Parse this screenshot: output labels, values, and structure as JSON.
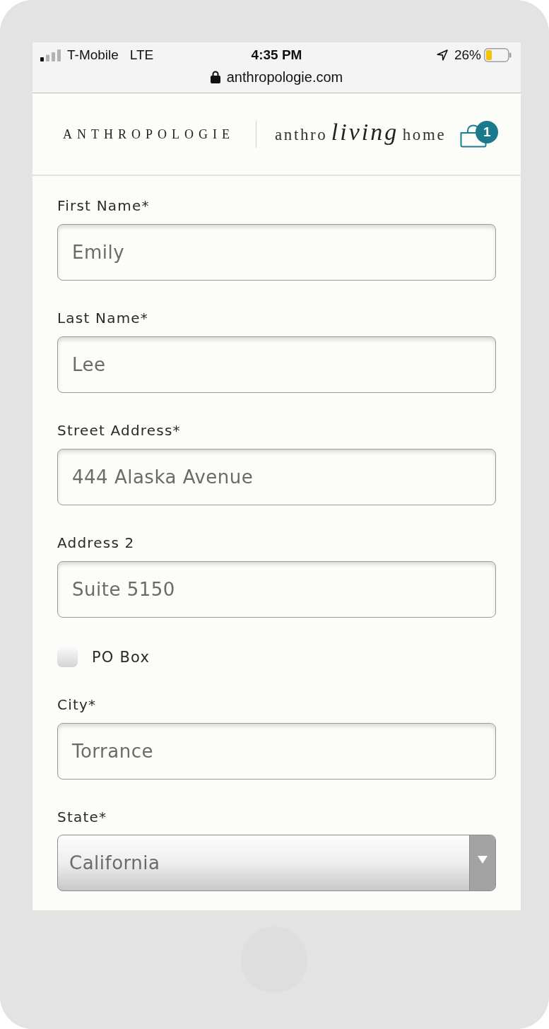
{
  "status_bar": {
    "carrier": "T-Mobile",
    "network": "LTE",
    "time": "4:35 PM",
    "battery": "26%"
  },
  "address_bar": {
    "url": "anthropologie.com"
  },
  "header": {
    "brand": "ANTHROPOLOGIE",
    "sub_brand": [
      {
        "text": "anthro",
        "kind": "serif"
      },
      {
        "text": "living",
        "kind": "script"
      },
      {
        "text": "home",
        "kind": "serif"
      }
    ],
    "cart_count": "1"
  },
  "form": {
    "fields": [
      {
        "kind": "text",
        "label": "First Name*",
        "value": "Emily"
      },
      {
        "kind": "text",
        "label": "Last Name*",
        "value": "Lee"
      },
      {
        "kind": "text",
        "label": "Street Address*",
        "value": "444 Alaska Avenue"
      },
      {
        "kind": "text",
        "label": "Address 2",
        "value": "Suite 5150"
      },
      {
        "kind": "checkbox",
        "label": "PO Box",
        "checked": false
      },
      {
        "kind": "text",
        "label": "City*",
        "value": "Torrance"
      },
      {
        "kind": "select",
        "label": "State*",
        "value": "California"
      }
    ]
  }
}
